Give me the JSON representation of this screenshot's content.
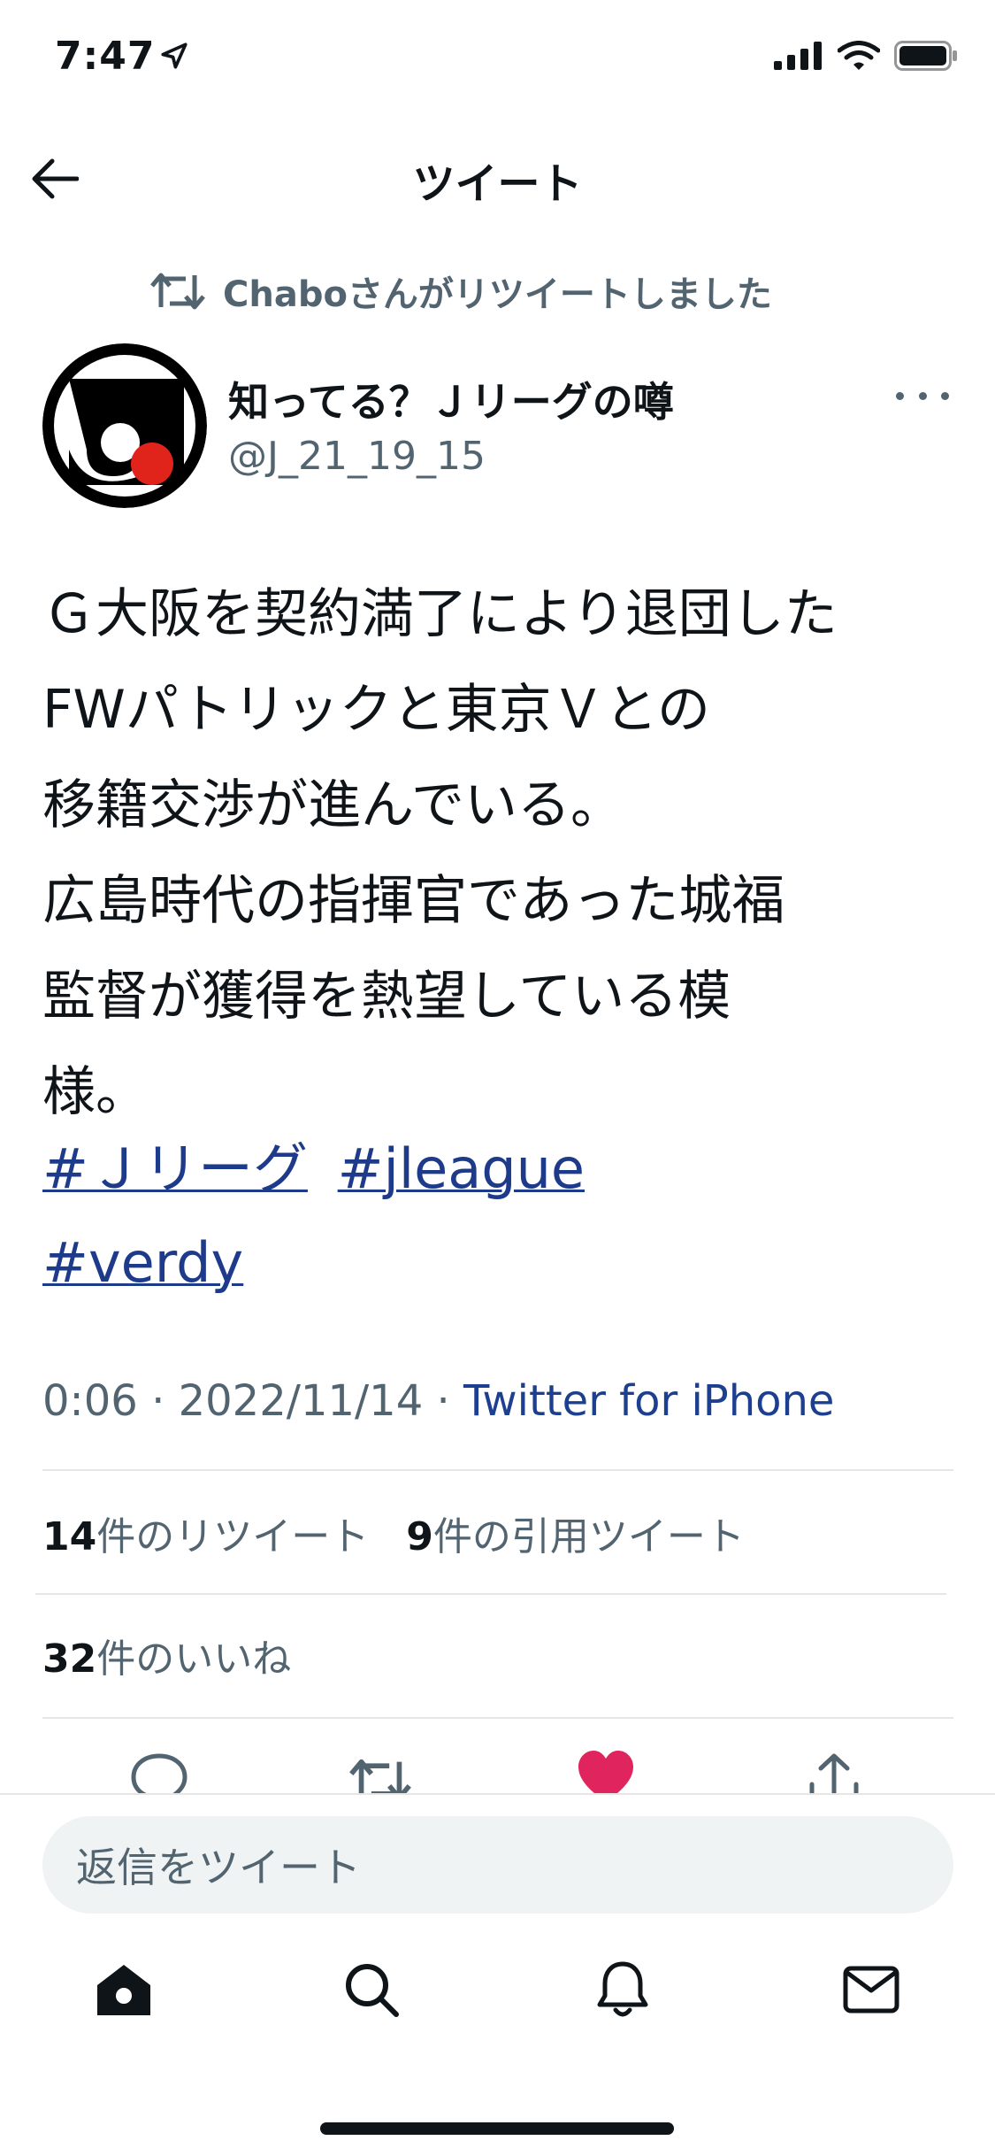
{
  "status_bar": {
    "time": "7:47"
  },
  "header": {
    "title": "ツイート"
  },
  "retweet_notice": "Chaboさんがリツイートしました",
  "author": {
    "name": "知ってる？Ｊリーグの噂",
    "handle": "@J_21_19_15"
  },
  "tweet": {
    "text": "Ｇ大阪を契約満了により退団した\nFWパトリックと東京Ｖとの\n移籍交渉が進んでいる。\n広島時代の指揮官であった城福\n監督が獲得を熱望している模\n様。",
    "hashtags": [
      "#Ｊリーグ",
      "#jleague",
      "#verdy"
    ]
  },
  "meta": {
    "time": "0:06",
    "date": "2022/11/14",
    "separator": "·",
    "source": "Twitter for iPhone"
  },
  "stats": {
    "retweets_count": "14",
    "retweets_label": "件のリツイート",
    "quotes_count": "9",
    "quotes_label": "件の引用ツイート",
    "likes_count": "32",
    "likes_label": "件のいいね"
  },
  "reply": {
    "placeholder": "返信をツイート"
  },
  "colors": {
    "link": "#1e3a8a",
    "like": "#e0245e",
    "secondary": "#536471"
  },
  "icons": [
    "back-arrow-icon",
    "location-arrow-icon",
    "signal-icon",
    "wifi-icon",
    "battery-icon",
    "retweet-icon",
    "more-icon",
    "reply-icon",
    "like-icon",
    "share-icon",
    "home-icon",
    "search-icon",
    "notifications-icon",
    "messages-icon"
  ]
}
